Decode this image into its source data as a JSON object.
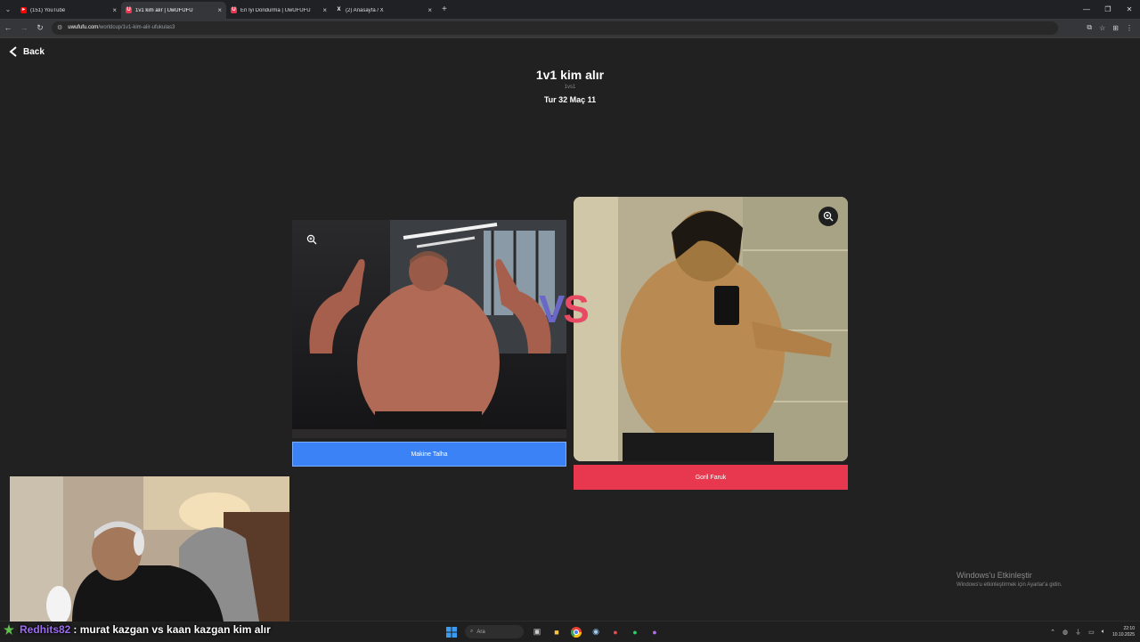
{
  "browser": {
    "tabs": [
      {
        "label": "(151) YouTube",
        "favicon": "youtube-icon",
        "color": "#ff0000",
        "active": false
      },
      {
        "label": "1v1 kim alır | UwUFUFU",
        "favicon": "uwufufu-icon",
        "color": "#e8384f",
        "active": true
      },
      {
        "label": "En İyi Dondurma | UwUFUFU",
        "favicon": "uwufufu-icon",
        "color": "#e8384f",
        "active": false
      },
      {
        "label": "(2) Anasayfa / X",
        "favicon": "x-icon",
        "color": "#ffffff",
        "active": false
      }
    ],
    "url_host": "uwufufu.com",
    "url_path": "/worldcup/1v1-kim-alir-ufukulas3"
  },
  "page": {
    "back_label": "Back",
    "title": "1v1 kim alır",
    "subtitle": "1vs1",
    "round_label": "Tur 32 Maç 11",
    "vs_v": "V",
    "vs_s": "S",
    "left": {
      "label": "Makine Talha",
      "button_color": "#3b82f6"
    },
    "right": {
      "label": "Goril Faruk",
      "button_color": "#e8384f"
    }
  },
  "stream": {
    "chat_user": "Redhits82",
    "chat_message": ": murat kazgan vs kaan kazgan kim alır"
  },
  "watermark": {
    "line1": "Windows'u Etkinleştir",
    "line2": "Windows'u etkinleştirmek için Ayarlar'a gidin."
  },
  "taskbar": {
    "search_placeholder": "Ara",
    "time": "22:10",
    "date": "10.10.2025"
  }
}
